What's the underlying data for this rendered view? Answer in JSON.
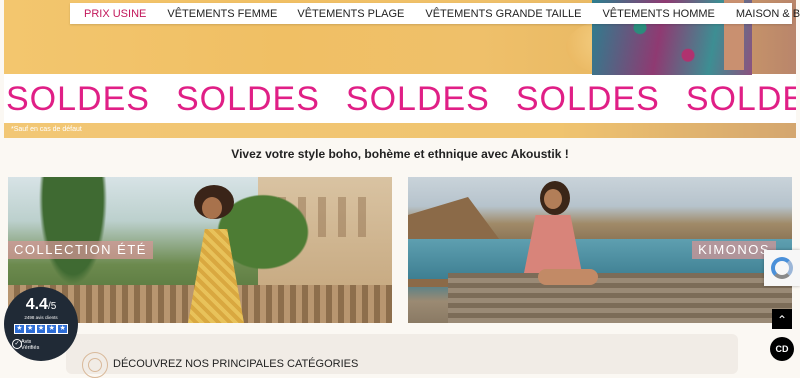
{
  "nav": {
    "items": [
      {
        "label": "PRIX USINE"
      },
      {
        "label": "VÊTEMENTS FEMME"
      },
      {
        "label": "VÊTEMENTS PLAGE"
      },
      {
        "label": "VÊTEMENTS GRANDE TAILLE"
      },
      {
        "label": "VÊTEMENTS HOMME"
      },
      {
        "label": "MAISON & BEAUTÉ"
      }
    ]
  },
  "hero": {
    "soldes": [
      "SOLDES",
      "SOLDES",
      "SOLDES",
      "SOLDES",
      "SOLDES"
    ],
    "disclaimer": "*Sauf en cas de défaut",
    "accent_color": "#e01f86"
  },
  "tagline": "Vivez votre style boho, bohème et ethnique avec Akoustik !",
  "collections": [
    {
      "label": "COLLECTION ÉTÉ"
    },
    {
      "label": "KIMONOS"
    }
  ],
  "categories": {
    "title": "DÉCOUVREZ NOS PRINCIPALES CATÉGORIES"
  },
  "rating": {
    "score": "4.4",
    "scale": "/5",
    "count": "2498 avis clients",
    "stars": 5,
    "verified_line1": "Avis",
    "verified_line2": "Vérifiés",
    "star_color": "#2d6dd6"
  },
  "widgets": {
    "scroll_top_icon": "chevron-up-icon",
    "cookie_label": "CD"
  }
}
